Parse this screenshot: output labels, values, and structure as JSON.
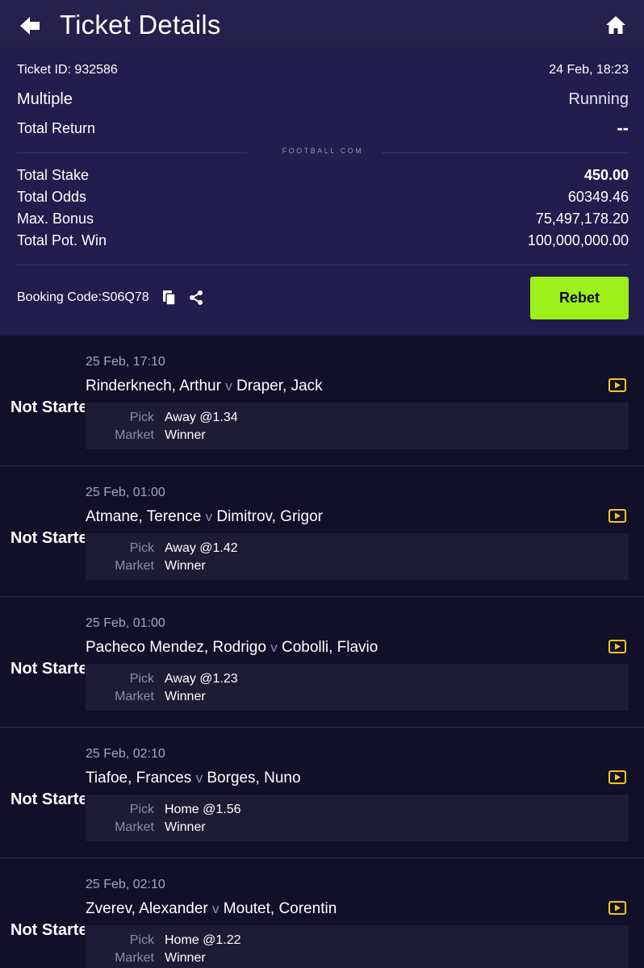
{
  "header": {
    "title": "Ticket Details",
    "back_icon": "arrow-left-icon",
    "home_icon": "home-icon"
  },
  "ticket": {
    "id_label": "Ticket ID: 932586",
    "datetime": "24 Feb, 18:23",
    "bet_type": "Multiple",
    "status": "Running",
    "total_return_label": "Total Return",
    "total_return_value": "--",
    "brand": "FOOTBALL.COM",
    "total_stake_label": "Total Stake",
    "total_stake_value": "450.00",
    "total_odds_label": "Total Odds",
    "total_odds_value": "60349.46",
    "max_bonus_label": "Max. Bonus",
    "max_bonus_value": "75,497,178.20",
    "pot_win_label": "Total Pot. Win",
    "pot_win_value": "100,000,000.00",
    "booking_code": "Booking Code:S06Q78",
    "rebet_label": "Rebet"
  },
  "colors": {
    "accent": "#9ef01a",
    "header_bg": "#25204c",
    "summary_bg": "#221d4d",
    "page_bg": "#121029",
    "live_icon": "#f5c518"
  },
  "bets": [
    {
      "status": "Not Started",
      "date": "25 Feb, 17:10",
      "home": "Rinderknech, Arthur",
      "vs": "v",
      "away": "Draper, Jack",
      "pick_label": "Pick",
      "pick": "Away @1.34",
      "market_label": "Market",
      "market": "Winner"
    },
    {
      "status": "Not Started",
      "date": "25 Feb, 01:00",
      "home": "Atmane, Terence",
      "vs": "v",
      "away": "Dimitrov, Grigor",
      "pick_label": "Pick",
      "pick": "Away @1.42",
      "market_label": "Market",
      "market": "Winner"
    },
    {
      "status": "Not Started",
      "date": "25 Feb, 01:00",
      "home": "Pacheco Mendez, Rodrigo",
      "vs": "v",
      "away": "Cobolli, Flavio",
      "pick_label": "Pick",
      "pick": "Away @1.23",
      "market_label": "Market",
      "market": "Winner"
    },
    {
      "status": "Not Started",
      "date": "25 Feb, 02:10",
      "home": "Tiafoe, Frances",
      "vs": "v",
      "away": "Borges, Nuno",
      "pick_label": "Pick",
      "pick": "Home @1.56",
      "market_label": "Market",
      "market": "Winner"
    },
    {
      "status": "Not Started",
      "date": "25 Feb, 02:10",
      "home": "Zverev, Alexander",
      "vs": "v",
      "away": "Moutet, Corentin",
      "pick_label": "Pick",
      "pick": "Home @1.22",
      "market_label": "Market",
      "market": "Winner"
    }
  ]
}
